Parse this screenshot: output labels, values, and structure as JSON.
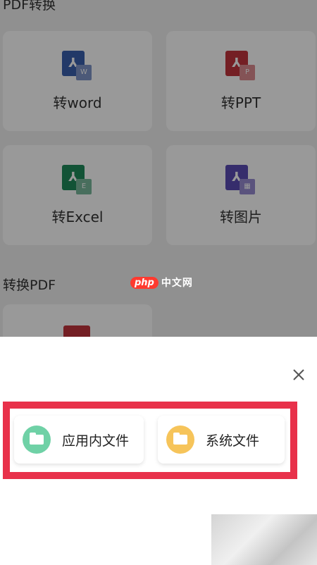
{
  "pdf_convert_section": {
    "title": "PDF转换"
  },
  "convert_to_pdf_section": {
    "title": "转换PDF"
  },
  "cards": [
    {
      "label": "转word",
      "icon": "pdf-to-word-icon",
      "color": "#3a5fae",
      "badge": "W"
    },
    {
      "label": "转PPT",
      "icon": "pdf-to-ppt-icon",
      "color": "#c2343c",
      "badge": "P"
    },
    {
      "label": "转Excel",
      "icon": "pdf-to-excel-icon",
      "color": "#1f8a5b",
      "badge": "E"
    },
    {
      "label": "转图片",
      "icon": "pdf-to-image-icon",
      "color": "#5b4bb5",
      "badge": "▦"
    }
  ],
  "watermark": {
    "brand": "php",
    "text": "中文网"
  },
  "sheet": {
    "options": [
      {
        "label": "应用内文件",
        "icon": "folder-icon",
        "color": "#6fd1a6"
      },
      {
        "label": "系统文件",
        "icon": "folder-icon",
        "color": "#f6c45a"
      }
    ],
    "highlight_color": "#e8314a"
  }
}
